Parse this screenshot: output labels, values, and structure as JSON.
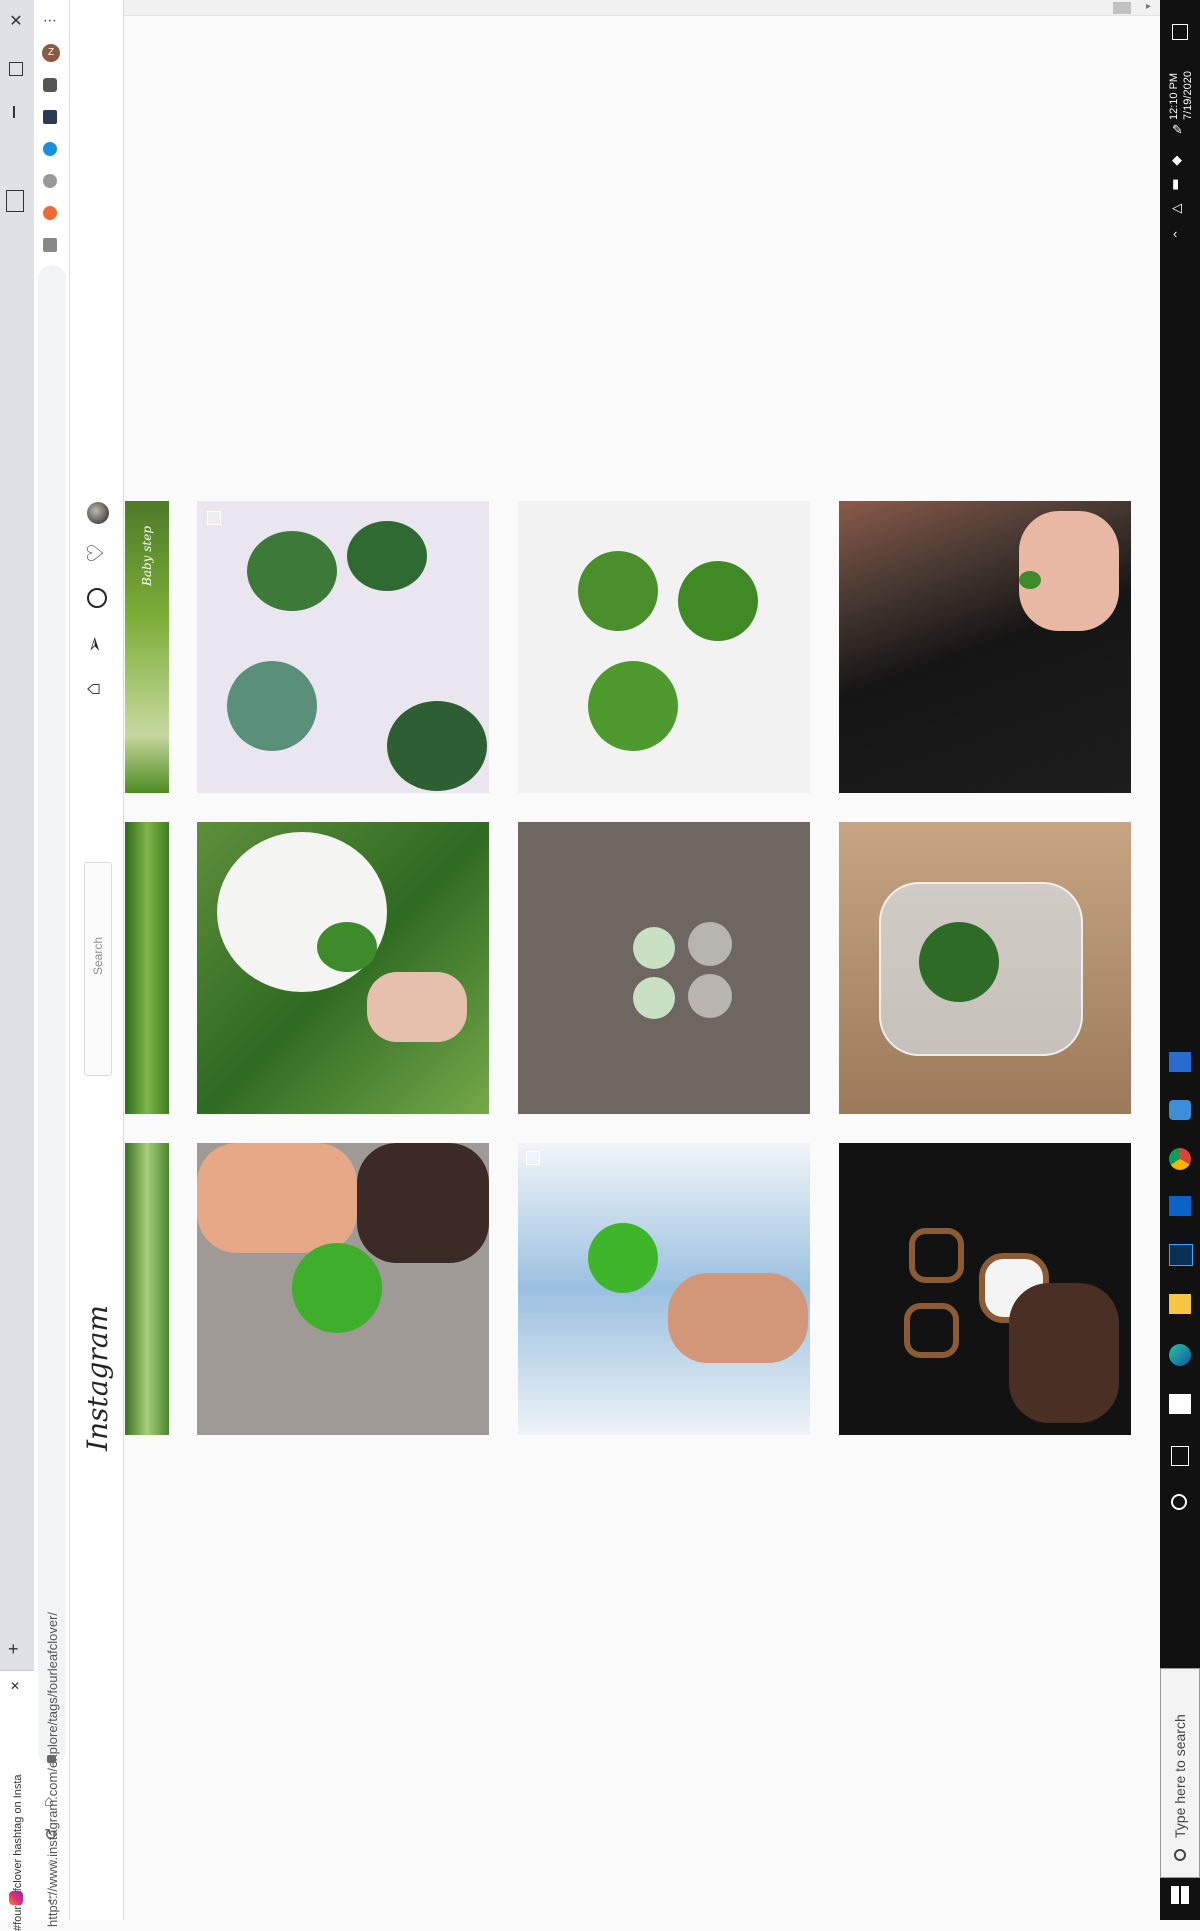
{
  "browser": {
    "tab_title": "#fourleafclover hashtag on Insta",
    "url": "https://www.instagram.com/explore/tags/fourleafclover/",
    "profile_initial": "Z"
  },
  "instagram": {
    "logo_text": "Instagram",
    "search_placeholder": "Search",
    "partial_caption": "Baby step"
  },
  "taskbar": {
    "search_placeholder": "Type here to search",
    "time": "12:10 PM",
    "date": "7/19/2020"
  },
  "grid": [
    {
      "row": 1,
      "col": 1,
      "desc": "clovers on paper"
    },
    {
      "row": 1,
      "col": 2,
      "desc": "four leaf clovers"
    },
    {
      "row": 1,
      "col": 3,
      "desc": "black dog"
    },
    {
      "row": 2,
      "col": 1,
      "desc": "white dog"
    },
    {
      "row": 2,
      "col": 2,
      "desc": "earrings"
    },
    {
      "row": 2,
      "col": 3,
      "desc": "clover in glass"
    },
    {
      "row": 3,
      "col": 1,
      "desc": "hand holding clover"
    },
    {
      "row": 3,
      "col": 2,
      "desc": "clover against sky"
    },
    {
      "row": 3,
      "col": 3,
      "desc": "clover cookie cutters"
    }
  ],
  "colors": {
    "accent": "#3cbd2b",
    "instagram_text": "#262626",
    "taskbar": "#111111"
  }
}
